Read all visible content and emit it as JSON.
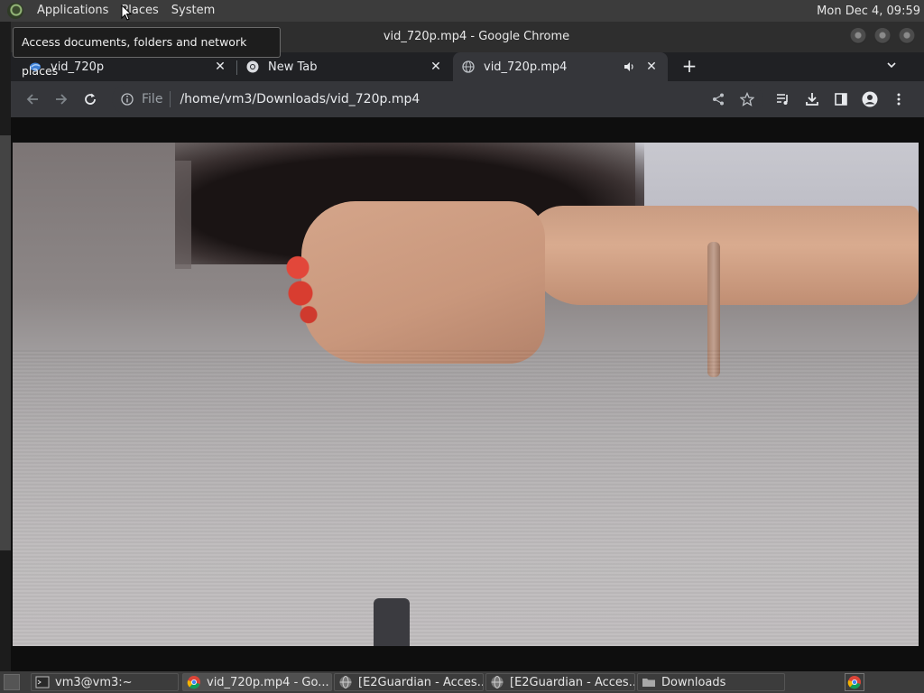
{
  "top_panel": {
    "menus": [
      "Applications",
      "Places",
      "System"
    ],
    "clock": "Mon Dec  4, 09:59"
  },
  "tooltip": {
    "text": "Access documents, folders and network places"
  },
  "window": {
    "title": "vid_720p.mp4 - Google Chrome"
  },
  "tabs": [
    {
      "label": "vid_720p",
      "icon": "tab-favicon-blue-icon",
      "active": false
    },
    {
      "label": "New Tab",
      "icon": "chrome-icon",
      "active": false
    },
    {
      "label": "vid_720p.mp4",
      "icon": "globe-icon",
      "active": true,
      "audio": true
    }
  ],
  "toolbar": {
    "scheme": "File",
    "url": "/home/vm3/Downloads/vid_720p.mp4"
  },
  "taskbar": {
    "tasks": [
      {
        "label": "vm3@vm3:~",
        "icon": "terminal-icon"
      },
      {
        "label": "vid_720p.mp4 - Go...",
        "icon": "chrome-icon",
        "active": true
      },
      {
        "label": "[E2Guardian - Acces...",
        "icon": "globe-icon"
      },
      {
        "label": "[E2Guardian - Acces...",
        "icon": "globe-icon"
      },
      {
        "label": "Downloads",
        "icon": "folder-icon"
      }
    ]
  },
  "colors": {
    "panel_bg": "#3c3c3c",
    "tabstrip_bg": "#202124",
    "toolbar_bg": "#35363a",
    "text": "#e8eaed"
  }
}
